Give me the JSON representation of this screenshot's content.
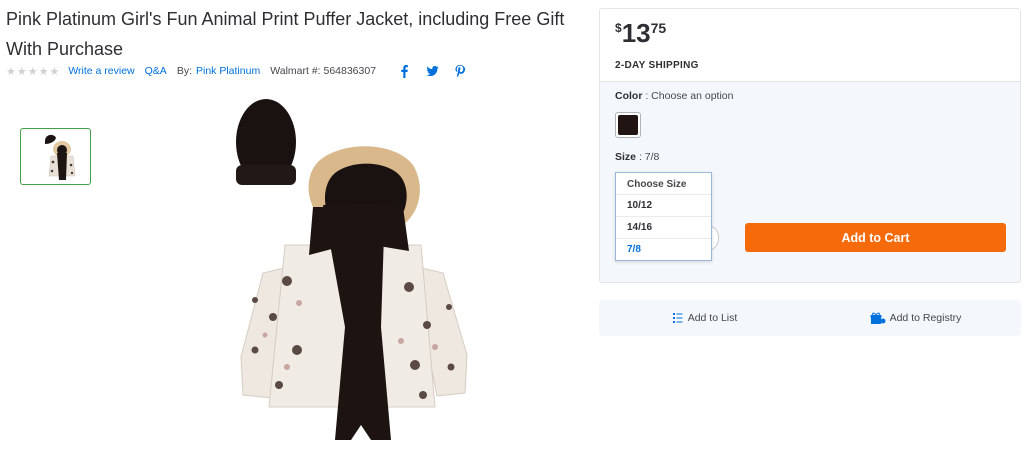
{
  "product": {
    "title": "Pink Platinum Girl's Fun Animal Print Puffer Jacket, including Free Gift With Purchase",
    "stars": "★★★★★",
    "write_review": "Write a review",
    "qa": "Q&A",
    "by_label": "By:",
    "brand": "Pink Platinum",
    "walmart_number": "Walmart #: 564836307"
  },
  "social": [
    "facebook-icon",
    "twitter-icon",
    "pinterest-icon"
  ],
  "price": {
    "currency": "$",
    "dollars": "13",
    "cents": "75"
  },
  "shipping": "2-DAY SHIPPING",
  "color": {
    "label": "Color",
    "value": ": Choose an option",
    "swatch_hex": "#201512"
  },
  "size": {
    "label": "Size",
    "value": ": 7/8",
    "menu_header": "Choose Size",
    "options": [
      "10/12",
      "14/16",
      "7/8"
    ],
    "selected": "7/8"
  },
  "cart_button": "Add to Cart",
  "actions": {
    "list": "Add to List",
    "registry": "Add to Registry"
  },
  "colors": {
    "accent_blue": "#0071dc",
    "cart_orange": "#f56a0a",
    "thumb_border": "#43a047"
  }
}
